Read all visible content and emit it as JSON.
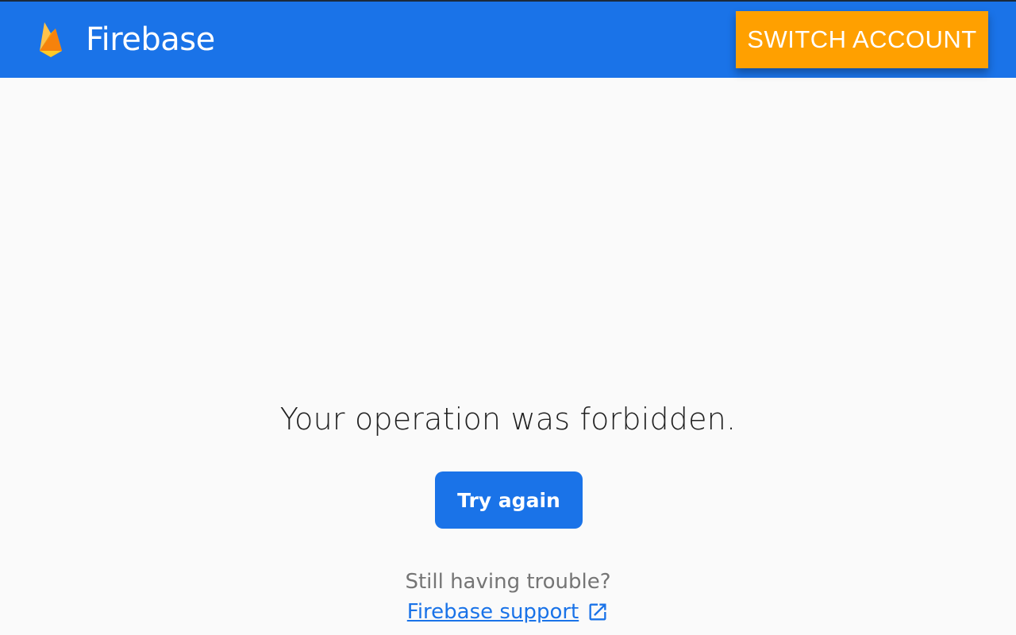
{
  "header": {
    "brand_name": "Firebase",
    "logo_icon": "firebase-flame-icon",
    "switch_account_label": "SWITCH ACCOUNT",
    "background_color": "#1a73e8",
    "switch_button_color": "#ffa000"
  },
  "main": {
    "message": "Your operation was forbidden.",
    "try_again_label": "Try again",
    "trouble_text": "Still having trouble?",
    "support_link_label": "Firebase support",
    "support_link_icon": "open-in-new-icon"
  }
}
